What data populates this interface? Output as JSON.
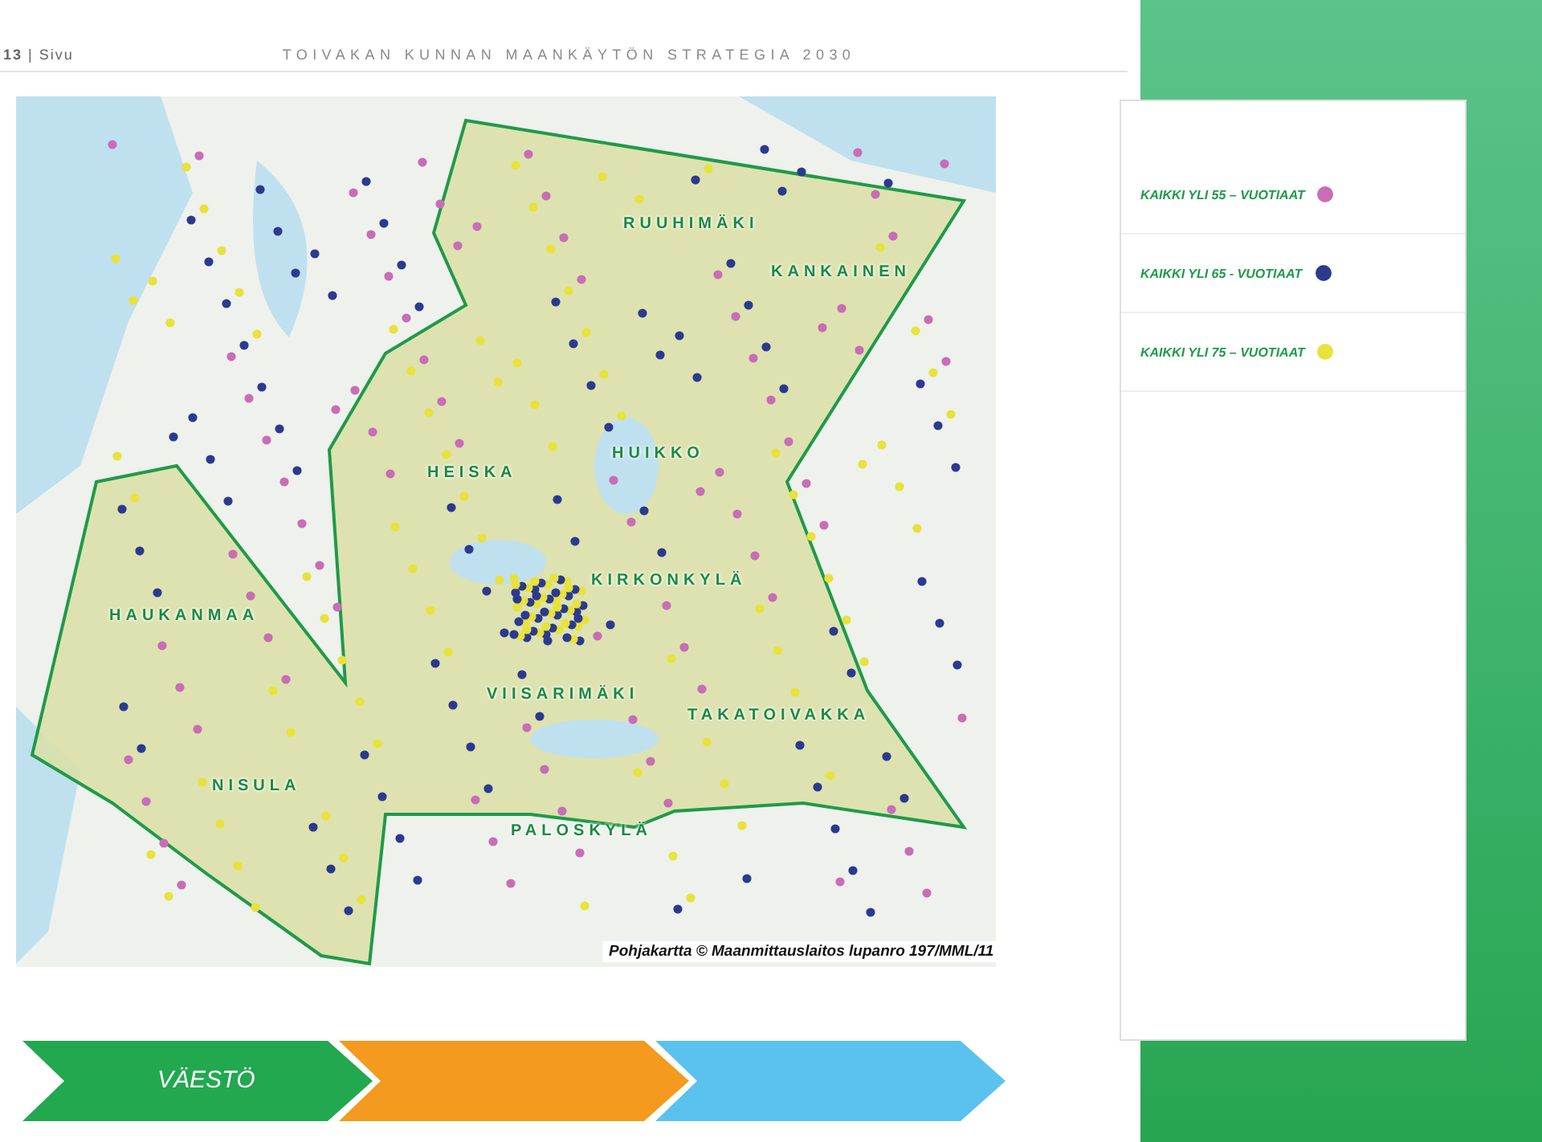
{
  "header": {
    "page": "**13** | Sivu",
    "title": "TOIVAKAN KUNNAN MAANKÄYTÖN STRATEGIA 2030"
  },
  "map": {
    "labels": [
      "RUUHIMÄKI",
      "KANKAINEN",
      "HEISKA",
      "HUIKKO",
      "KIRKONKYLÄ",
      "HAUKANMAA",
      "VIISARIMÄKI",
      "TAKATOIVAKKA",
      "NISULA",
      "PALOSKYLÄ"
    ],
    "caption": "Pohjakartta © Maanmittauslaitos lupanro 197/MML/11"
  },
  "legend": [
    {
      "label": "KAIKKI YLI 55 – VUOTIAAT",
      "color": "#c86db6"
    },
    {
      "label": "KAIKKI YLI 65 - VUOTIAAT",
      "color": "#2b3a8f"
    },
    {
      "label": "KAIKKI YLI 75 – VUOTIAAT",
      "color": "#e8e23a"
    }
  ],
  "steps": [
    {
      "label": "VÄESTÖ",
      "color": "#22a84f"
    },
    {
      "color": "#f39a1f"
    },
    {
      "color": "#5bc1ef"
    }
  ]
}
